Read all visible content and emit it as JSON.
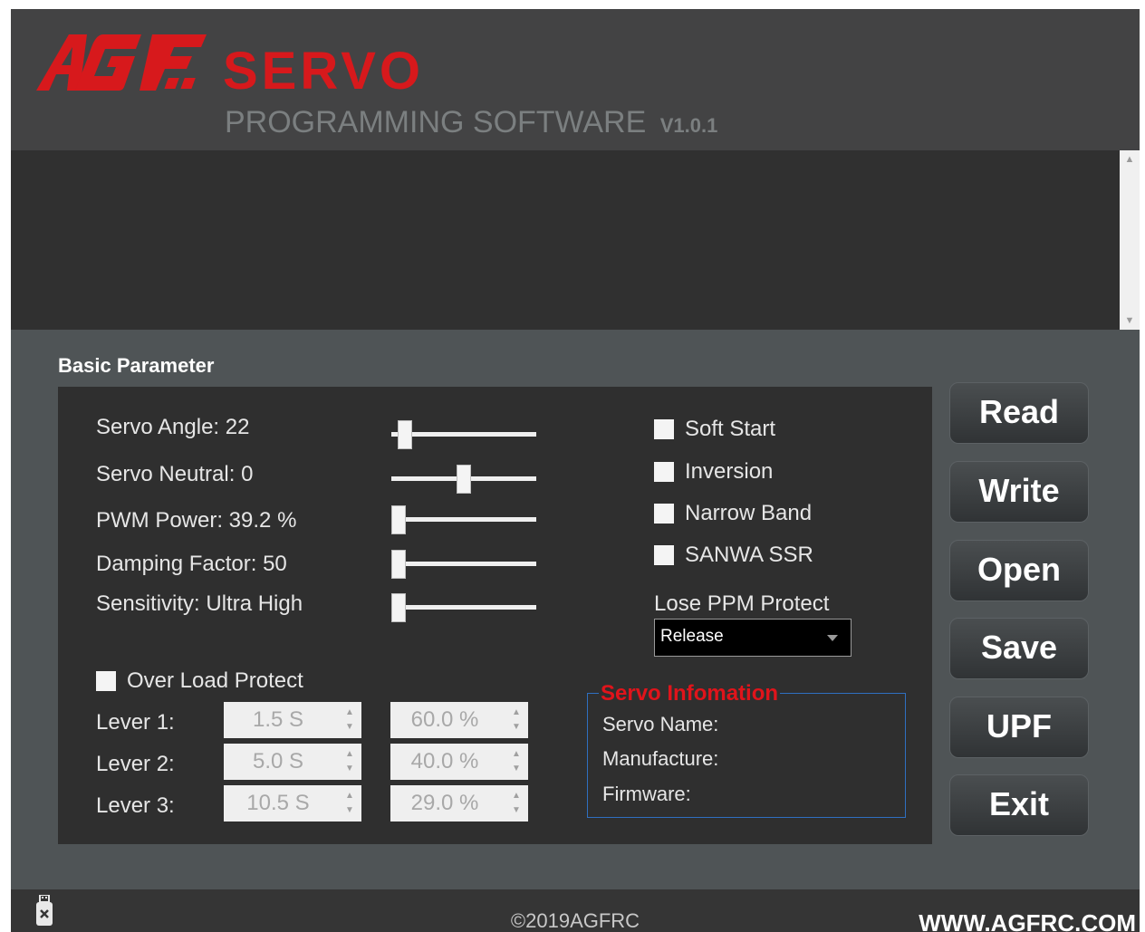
{
  "header": {
    "logo_text": "AGF",
    "logo_servo": "SERVO",
    "subtitle": "PROGRAMMING SOFTWARE",
    "version": "V1.0.1"
  },
  "colors": {
    "accent_red": "#d7191c",
    "info_border": "#2f6fc0",
    "panel_bg": "#2f2f2f"
  },
  "basic": {
    "section_title": "Basic Parameter",
    "params": [
      {
        "label": "Servo Angle: 22",
        "slider_fraction": 0.05
      },
      {
        "label": "Servo Neutral: 0",
        "slider_fraction": 0.5
      },
      {
        "label": "PWM Power: 39.2 %",
        "slider_fraction": 0.0
      },
      {
        "label": "Damping Factor: 50",
        "slider_fraction": 0.0
      },
      {
        "label": "Sensitivity: Ultra High",
        "slider_fraction": 0.0
      }
    ],
    "options": [
      {
        "label": "Soft Start",
        "checked": false
      },
      {
        "label": "Inversion",
        "checked": false
      },
      {
        "label": "Narrow Band",
        "checked": false
      },
      {
        "label": "SANWA SSR",
        "checked": false
      }
    ],
    "lose_ppm": {
      "label": "Lose PPM Protect",
      "value": "Release"
    },
    "overload": {
      "label": "Over Load Protect",
      "checked": false
    },
    "levers": [
      {
        "label": "Lever 1:",
        "time": "1.5 S",
        "percent": "60.0 %"
      },
      {
        "label": "Lever 2:",
        "time": "5.0 S",
        "percent": "40.0 %"
      },
      {
        "label": "Lever 3:",
        "time": "10.5 S",
        "percent": "29.0 %"
      }
    ],
    "servo_info": {
      "title": "Servo Infomation",
      "name_label": "Servo Name:",
      "manufacture_label": "Manufacture:",
      "firmware_label": "Firmware:"
    }
  },
  "buttons": {
    "read": "Read",
    "write": "Write",
    "open": "Open",
    "save": "Save",
    "upf": "UPF",
    "exit": "Exit"
  },
  "footer": {
    "copyright": "©2019AGFRC",
    "website": "WWW.AGFRC.COM",
    "usb_icon": "usb-disconnected-icon"
  }
}
